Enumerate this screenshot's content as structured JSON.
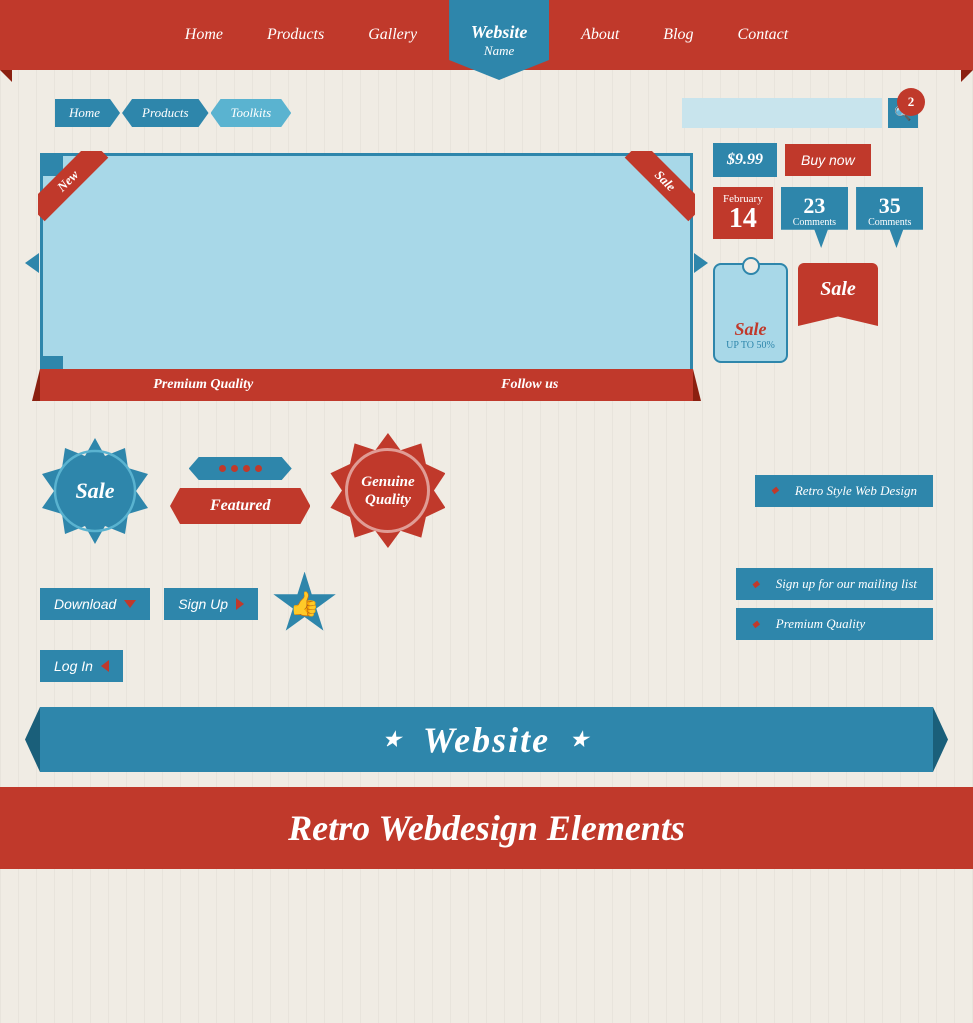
{
  "nav": {
    "items": [
      "Home",
      "Products",
      "Gallery",
      "About",
      "Blog",
      "Contact"
    ],
    "logo_line1": "Website",
    "logo_line2": "Name"
  },
  "breadcrumb": {
    "items": [
      "Home",
      "Products",
      "Toolkits"
    ]
  },
  "search": {
    "placeholder": ""
  },
  "notification": {
    "count": "2"
  },
  "price": {
    "value": "$9.99",
    "buy_label": "Buy now"
  },
  "date": {
    "month": "February",
    "day": "14"
  },
  "comments1": {
    "count": "23",
    "label": "Comments"
  },
  "comments2": {
    "count": "35",
    "label": "Comments"
  },
  "panel": {
    "ribbon_new": "New",
    "ribbon_sale": "Sale",
    "ribbon_premium": "Premium Quality",
    "ribbon_follow": "Follow us"
  },
  "badges": {
    "sale_label": "Sale",
    "featured_label": "Featured",
    "genuine_line1": "Genuine",
    "genuine_line2": "Quality",
    "hanger_sale": "Sale",
    "hanger_sub": "UP TO 50%",
    "bookmark_sale": "Sale"
  },
  "buttons": {
    "download": "Download",
    "signup": "Sign Up",
    "login": "Log In"
  },
  "arrows": {
    "retro": "Retro Style Web Design",
    "mailing": "Sign up for our mailing list",
    "premium": "Premium Quality"
  },
  "banner": {
    "text": "Website"
  },
  "footer": {
    "title": "Retro Webdesign Elements"
  },
  "colors": {
    "blue": "#2e86ab",
    "red": "#c0392b",
    "light_blue": "#a8d8e8"
  }
}
